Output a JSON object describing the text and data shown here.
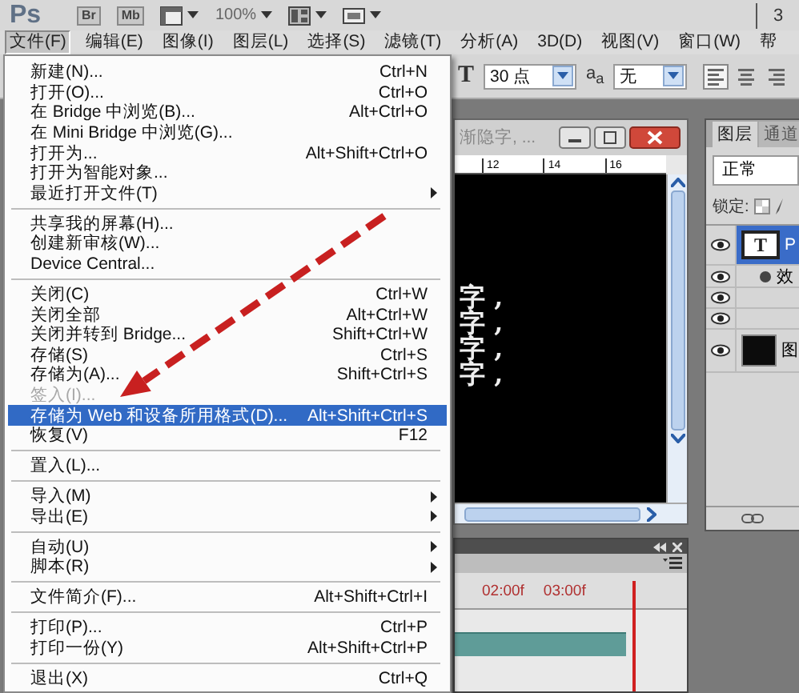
{
  "app_bar": {
    "logo": "Ps",
    "buttons": [
      "Br",
      "Mb"
    ],
    "zoom": "100%",
    "workspace": "3"
  },
  "menu_bar": [
    {
      "label": "文件(F)",
      "selected": true
    },
    {
      "label": "编辑(E)",
      "selected": false
    },
    {
      "label": "图像(I)",
      "selected": false
    },
    {
      "label": "图层(L)",
      "selected": false
    },
    {
      "label": "选择(S)",
      "selected": false
    },
    {
      "label": "滤镜(T)",
      "selected": false
    },
    {
      "label": "分析(A)",
      "selected": false
    },
    {
      "label": "3D(D)",
      "selected": false
    },
    {
      "label": "视图(V)",
      "selected": false
    },
    {
      "label": "窗口(W)",
      "selected": false
    },
    {
      "label": "帮",
      "selected": false
    }
  ],
  "file_menu": [
    {
      "kind": "item",
      "label": "新建(N)...",
      "shortcut": "Ctrl+N",
      "submenu": false,
      "disabled": false,
      "selected": false
    },
    {
      "kind": "item",
      "label": "打开(O)...",
      "shortcut": "Ctrl+O",
      "submenu": false,
      "disabled": false,
      "selected": false
    },
    {
      "kind": "item",
      "label": "在 Bridge 中浏览(B)...",
      "shortcut": "Alt+Ctrl+O",
      "submenu": false,
      "disabled": false,
      "selected": false
    },
    {
      "kind": "item",
      "label": "在 Mini Bridge 中浏览(G)...",
      "submenu": false,
      "disabled": false,
      "selected": false
    },
    {
      "kind": "item",
      "label": "打开为...",
      "shortcut": "Alt+Shift+Ctrl+O",
      "submenu": false,
      "disabled": false,
      "selected": false
    },
    {
      "kind": "item",
      "label": "打开为智能对象...",
      "submenu": false,
      "disabled": false,
      "selected": false
    },
    {
      "kind": "item",
      "label": "最近打开文件(T)",
      "submenu": true,
      "disabled": false,
      "selected": false
    },
    {
      "kind": "separator"
    },
    {
      "kind": "item",
      "label": "共享我的屏幕(H)...",
      "submenu": false,
      "disabled": false,
      "selected": false
    },
    {
      "kind": "item",
      "label": "创建新审核(W)...",
      "submenu": false,
      "disabled": false,
      "selected": false
    },
    {
      "kind": "item",
      "label": "Device Central...",
      "submenu": false,
      "disabled": false,
      "selected": false
    },
    {
      "kind": "separator"
    },
    {
      "kind": "item",
      "label": "关闭(C)",
      "shortcut": "Ctrl+W",
      "submenu": false,
      "disabled": false,
      "selected": false
    },
    {
      "kind": "item",
      "label": "关闭全部",
      "shortcut": "Alt+Ctrl+W",
      "submenu": false,
      "disabled": false,
      "selected": false
    },
    {
      "kind": "item",
      "label": "关闭并转到 Bridge...",
      "shortcut": "Shift+Ctrl+W",
      "submenu": false,
      "disabled": false,
      "selected": false
    },
    {
      "kind": "item",
      "label": "存储(S)",
      "shortcut": "Ctrl+S",
      "submenu": false,
      "disabled": false,
      "selected": false
    },
    {
      "kind": "item",
      "label": "存储为(A)...",
      "shortcut": "Shift+Ctrl+S",
      "submenu": false,
      "disabled": false,
      "selected": false
    },
    {
      "kind": "item",
      "label": "签入(I)...",
      "submenu": false,
      "disabled": true,
      "selected": false
    },
    {
      "kind": "item",
      "label": "存储为 Web 和设备所用格式(D)...",
      "shortcut": "Alt+Shift+Ctrl+S",
      "submenu": false,
      "disabled": false,
      "selected": true
    },
    {
      "kind": "item",
      "label": "恢复(V)",
      "shortcut": "F12",
      "submenu": false,
      "disabled": false,
      "selected": false
    },
    {
      "kind": "separator"
    },
    {
      "kind": "item",
      "label": "置入(L)...",
      "submenu": false,
      "disabled": false,
      "selected": false
    },
    {
      "kind": "separator"
    },
    {
      "kind": "item",
      "label": "导入(M)",
      "submenu": true,
      "disabled": false,
      "selected": false
    },
    {
      "kind": "item",
      "label": "导出(E)",
      "submenu": true,
      "disabled": false,
      "selected": false
    },
    {
      "kind": "separator"
    },
    {
      "kind": "item",
      "label": "自动(U)",
      "submenu": true,
      "disabled": false,
      "selected": false
    },
    {
      "kind": "item",
      "label": "脚本(R)",
      "submenu": true,
      "disabled": false,
      "selected": false
    },
    {
      "kind": "separator"
    },
    {
      "kind": "item",
      "label": "文件简介(F)...",
      "shortcut": "Alt+Shift+Ctrl+I",
      "submenu": false,
      "disabled": false,
      "selected": false
    },
    {
      "kind": "separator"
    },
    {
      "kind": "item",
      "label": "打印(P)...",
      "shortcut": "Ctrl+P",
      "submenu": false,
      "disabled": false,
      "selected": false
    },
    {
      "kind": "item",
      "label": "打印一份(Y)",
      "shortcut": "Alt+Shift+Ctrl+P",
      "submenu": false,
      "disabled": false,
      "selected": false
    },
    {
      "kind": "separator"
    },
    {
      "kind": "item",
      "label": "退出(X)",
      "shortcut": "Ctrl+Q",
      "submenu": false,
      "disabled": false,
      "selected": false
    }
  ],
  "options_bar": {
    "tool_glyph": "T",
    "font_size": "30 点",
    "anti_alias_glyph": "a$_{a}$",
    "anti_alias": "无"
  },
  "document": {
    "title": "渐隐字, ...",
    "ruler": [
      "12",
      "14",
      "16"
    ],
    "lines": [
      "字 ,",
      "字 ,",
      "字 ,",
      "字 ,"
    ]
  },
  "layers_panel": {
    "tabs": [
      {
        "label": "图层",
        "selected": true
      },
      {
        "label": "通道",
        "selected": false
      }
    ],
    "blend_mode": "正常",
    "lock_label": "锁定:",
    "layers": [
      {
        "kind": "text",
        "thumb": "T",
        "name": "P",
        "visible": true,
        "selected": true,
        "children": [
          {
            "kind": "effects",
            "name": "效",
            "visible": true,
            "selected": false,
            "children": [
              {
                "kind": "effect",
                "visible": true,
                "selected": false
              },
              {
                "kind": "effect",
                "visible": true,
                "selected": false
              }
            ]
          }
        ]
      },
      {
        "kind": "image",
        "name": "图",
        "visible": true,
        "selected": false
      }
    ]
  },
  "timeline": {
    "times": [
      "02:00f",
      "03:00f"
    ]
  }
}
